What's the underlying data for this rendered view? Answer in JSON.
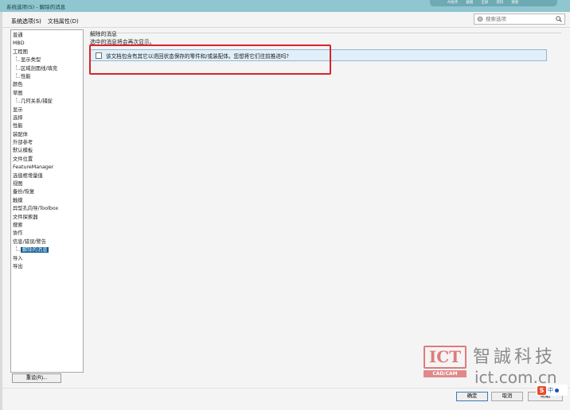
{
  "window": {
    "title": "系统选项(S) - 解除的消息",
    "top_links": [
      "AI助手",
      "截图",
      "全屏",
      "资料",
      "搜索"
    ]
  },
  "tabs": [
    {
      "label": "系统选项(S)"
    },
    {
      "label": "文档属性(D)"
    }
  ],
  "search": {
    "placeholder": "搜索选项"
  },
  "tree": {
    "items": [
      {
        "label": "普通",
        "child": false
      },
      {
        "label": "MBD",
        "child": false
      },
      {
        "label": "工程图",
        "child": false
      },
      {
        "label": "显示类型",
        "child": true
      },
      {
        "label": "区域剖面线/填充",
        "child": true
      },
      {
        "label": "性能",
        "child": true
      },
      {
        "label": "颜色",
        "child": false
      },
      {
        "label": "草图",
        "child": false
      },
      {
        "label": "几何关系/捕捉",
        "child": true
      },
      {
        "label": "显示",
        "child": false
      },
      {
        "label": "选择",
        "child": false
      },
      {
        "label": "性能",
        "child": false
      },
      {
        "label": "装配体",
        "child": false
      },
      {
        "label": "外部参考",
        "child": false
      },
      {
        "label": "默认模板",
        "child": false
      },
      {
        "label": "文件位置",
        "child": false
      },
      {
        "label": "FeatureManager",
        "child": false
      },
      {
        "label": "选值框增量值",
        "child": false
      },
      {
        "label": "视图",
        "child": false
      },
      {
        "label": "备份/恢复",
        "child": false
      },
      {
        "label": "触摸",
        "child": false
      },
      {
        "label": "异型孔向导/Toolbox",
        "child": false
      },
      {
        "label": "文件探索器",
        "child": false
      },
      {
        "label": "搜索",
        "child": false
      },
      {
        "label": "协作",
        "child": false
      },
      {
        "label": "信息/错误/警告",
        "child": false
      },
      {
        "label": "解除的消息",
        "child": true,
        "selected": true
      },
      {
        "label": "导入",
        "child": false
      },
      {
        "label": "导出",
        "child": false
      }
    ]
  },
  "reset_button": "重设(R)...",
  "content": {
    "group_title": "解除的消息",
    "description": "选中的消息将会再次显示。",
    "messages": [
      {
        "text": "该文档包含有其它以退回状态保存的零件和/或装配体。您想将它们往前推进吗?",
        "checked": false
      }
    ]
  },
  "watermark": {
    "logo": "ICT",
    "logo_sub": "CAD/CAM",
    "name_cn": "智誠科技",
    "url": "ict.com.cn"
  },
  "buttons": {
    "ok": "确定",
    "cancel": "取消",
    "help": "帮助"
  },
  "ime": {
    "label": "中"
  },
  "colors": {
    "accent": "#0a5a93",
    "highlight_box": "#d8232a",
    "titlebar": "#8fc6cf"
  }
}
